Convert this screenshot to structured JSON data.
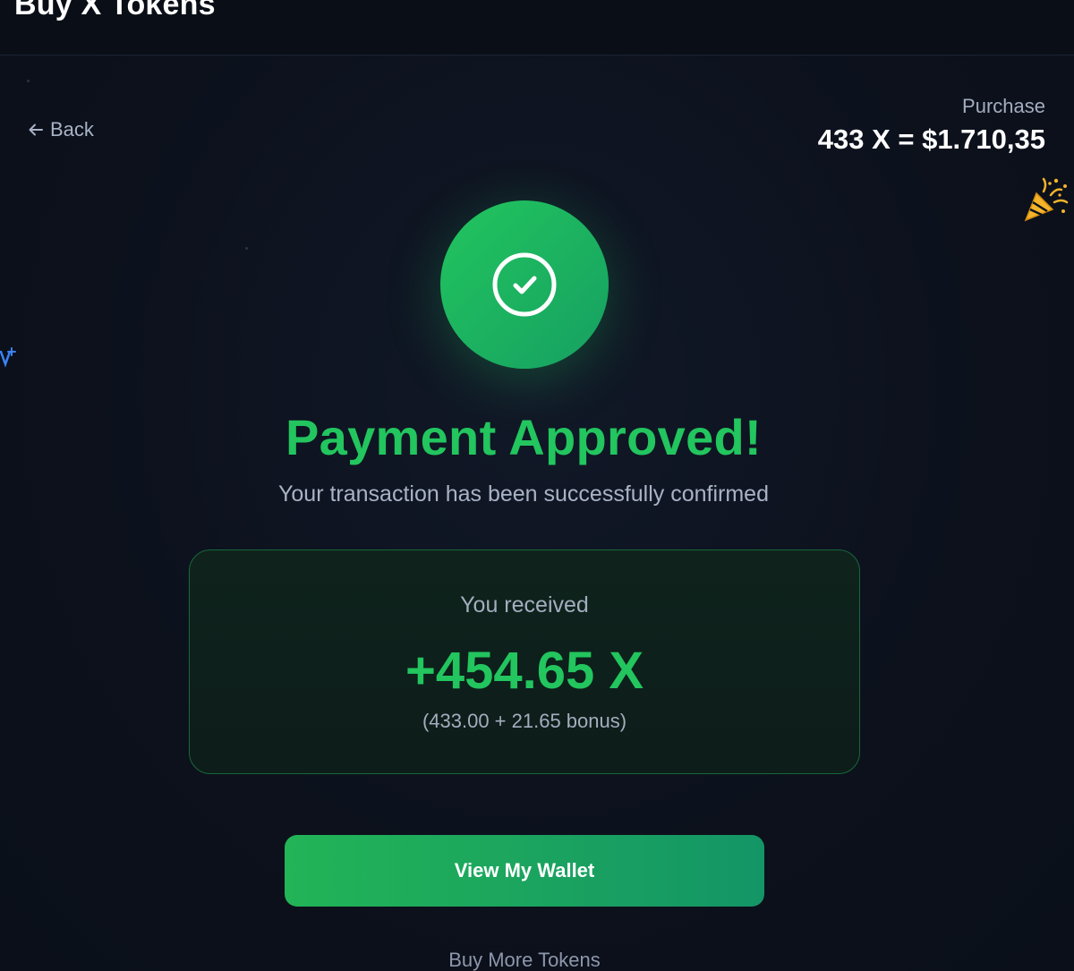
{
  "header": {
    "title": "Buy X Tokens"
  },
  "nav": {
    "back_label": "Back"
  },
  "purchase": {
    "label": "Purchase",
    "value": "433 X = $1.710,35"
  },
  "status": {
    "title": "Payment Approved!",
    "subtitle": "Your transaction has been successfully confirmed"
  },
  "received": {
    "label": "You received",
    "amount": "+454.65 X",
    "detail": "(433.00 + 21.65 bonus)"
  },
  "actions": {
    "view_wallet": "View My Wallet",
    "buy_more": "Buy More Tokens"
  },
  "colors": {
    "accent": "#22c55e",
    "background": "#0c111c",
    "card_border": "#17683a",
    "party_icon": "#f5b32a",
    "sparkle_icon": "#3b82f6"
  },
  "icons": {
    "back": "arrow-left-icon",
    "success": "check-circle-icon",
    "celebration": "party-popper-icon",
    "decoration": "sparkle-icon"
  }
}
